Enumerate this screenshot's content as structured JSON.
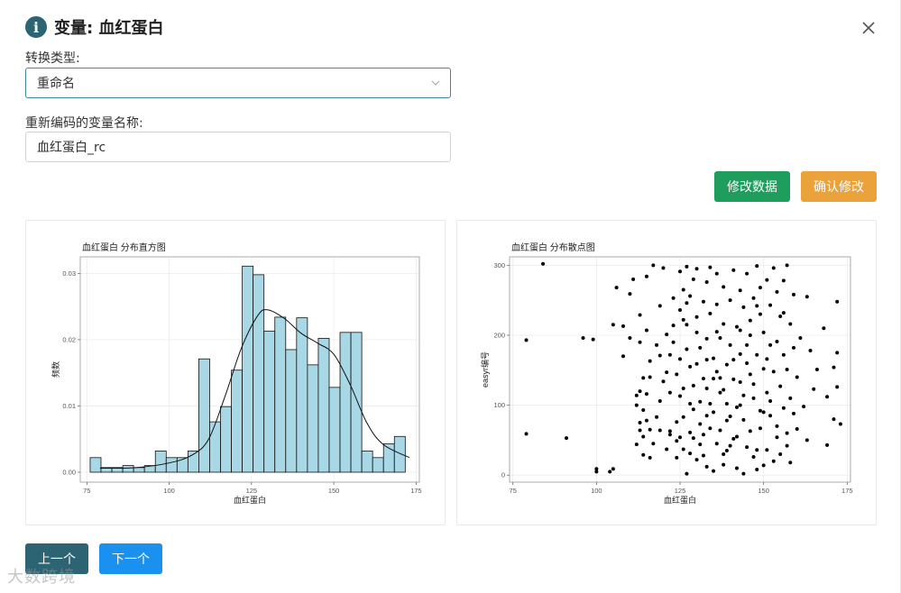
{
  "dialog": {
    "title": "变量: 血红蛋白",
    "info_icon_glyph": "i",
    "close_icon": "close-icon"
  },
  "form": {
    "convert_type_label": "转换类型:",
    "convert_type_value": "重命名",
    "new_name_label": "重新编码的变量名称:",
    "new_name_value": "血红蛋白_rc"
  },
  "actions": {
    "modify_data": "修改数据",
    "confirm_modify": "确认修改",
    "prev": "上一个",
    "next": "下一个"
  },
  "colors": {
    "accent": "#2c6473",
    "green": "#1e9d5d",
    "orange": "#eba23b",
    "blue": "#1a90ef",
    "bar_fill": "#a8d8e6"
  },
  "watermark": "大数跨境",
  "chart_data": [
    {
      "type": "bar",
      "title": "血红蛋白 分布直方图",
      "xlabel": "血红蛋白",
      "ylabel": "频数",
      "xlim": [
        73,
        176
      ],
      "ylim": [
        -0.0015,
        0.0325
      ],
      "xticks": [
        75,
        100,
        125,
        150,
        175
      ],
      "yticks": [
        0.0,
        0.01,
        0.02,
        0.03
      ],
      "ytick_labels": [
        "0.00",
        "0.01",
        "0.02",
        "0.03"
      ],
      "grid": true,
      "bin_start": 76,
      "bin_width": 3.3,
      "values": [
        0.0022,
        0.0007,
        0.0007,
        0.001,
        0.0007,
        0.001,
        0.0032,
        0.0022,
        0.0022,
        0.0032,
        0.0171,
        0.0076,
        0.0099,
        0.0154,
        0.0311,
        0.0298,
        0.0213,
        0.0234,
        0.0185,
        0.0233,
        0.0162,
        0.0202,
        0.0128,
        0.0211,
        0.0211,
        0.0032,
        0.0022,
        0.0043,
        0.0054
      ],
      "density_curve": [
        [
          79,
          0.0006
        ],
        [
          90,
          0.0007
        ],
        [
          100,
          0.0014
        ],
        [
          107,
          0.0026
        ],
        [
          112,
          0.005
        ],
        [
          117,
          0.0115
        ],
        [
          122,
          0.0188
        ],
        [
          127,
          0.0237
        ],
        [
          130,
          0.0245
        ],
        [
          135,
          0.0232
        ],
        [
          140,
          0.021
        ],
        [
          145,
          0.0195
        ],
        [
          150,
          0.0178
        ],
        [
          155,
          0.0132
        ],
        [
          160,
          0.0075
        ],
        [
          165,
          0.0042
        ],
        [
          173,
          0.0022
        ]
      ]
    },
    {
      "type": "scatter",
      "title": "血红蛋白 分布散点图",
      "xlabel": "血红蛋白",
      "ylabel": "easyr编号",
      "xlim": [
        74,
        176
      ],
      "ylim": [
        -10,
        312
      ],
      "xticks": [
        75,
        100,
        125,
        150,
        175
      ],
      "yticks": [
        0,
        100,
        200,
        300
      ],
      "grid": true,
      "points": [
        [
          79,
          193
        ],
        [
          79,
          59
        ],
        [
          84,
          302
        ],
        [
          91,
          53
        ],
        [
          96,
          196
        ],
        [
          99,
          194
        ],
        [
          100,
          9
        ],
        [
          100,
          5
        ],
        [
          104,
          5
        ],
        [
          105,
          9
        ],
        [
          105,
          215
        ],
        [
          106,
          268
        ],
        [
          108,
          213
        ],
        [
          108,
          170
        ],
        [
          110,
          259
        ],
        [
          110,
          196
        ],
        [
          111,
          280
        ],
        [
          112,
          44
        ],
        [
          112,
          114
        ],
        [
          112,
          100
        ],
        [
          113,
          64
        ],
        [
          113,
          190
        ],
        [
          113,
          229
        ],
        [
          113,
          75
        ],
        [
          114,
          139
        ],
        [
          114,
          93
        ],
        [
          114,
          55
        ],
        [
          114,
          29
        ],
        [
          115,
          284
        ],
        [
          115,
          207
        ],
        [
          115,
          78
        ],
        [
          115,
          116
        ],
        [
          116,
          65
        ],
        [
          116,
          25
        ],
        [
          116,
          163
        ],
        [
          117,
          300
        ],
        [
          118,
          83
        ],
        [
          119,
          242
        ],
        [
          119,
          171
        ],
        [
          119,
          106
        ],
        [
          120,
          296
        ],
        [
          120,
          134
        ],
        [
          121,
          37
        ],
        [
          121,
          147
        ],
        [
          122,
          63
        ],
        [
          122,
          118
        ],
        [
          122,
          58
        ],
        [
          123,
          253
        ],
        [
          123,
          190
        ],
        [
          123,
          214
        ],
        [
          124,
          49
        ],
        [
          124,
          25
        ],
        [
          124,
          76
        ],
        [
          125,
          291
        ],
        [
          125,
          236
        ],
        [
          125,
          166
        ],
        [
          125,
          113
        ],
        [
          126,
          37
        ],
        [
          126,
          83
        ],
        [
          126,
          265
        ],
        [
          126,
          124
        ],
        [
          127,
          298
        ],
        [
          127,
          2
        ],
        [
          127,
          215
        ],
        [
          127,
          180
        ],
        [
          128,
          256
        ],
        [
          128,
          155
        ],
        [
          128,
          61
        ],
        [
          128,
          31
        ],
        [
          129,
          128
        ],
        [
          129,
          280
        ],
        [
          129,
          94
        ],
        [
          130,
          295
        ],
        [
          130,
          204
        ],
        [
          130,
          226
        ],
        [
          130,
          159
        ],
        [
          131,
          105
        ],
        [
          131,
          73
        ],
        [
          131,
          44
        ],
        [
          132,
          248
        ],
        [
          132,
          138
        ],
        [
          132,
          28
        ],
        [
          133,
          276
        ],
        [
          133,
          195
        ],
        [
          133,
          124
        ],
        [
          133,
          12
        ],
        [
          134,
          297
        ],
        [
          134,
          231
        ],
        [
          134,
          67
        ],
        [
          135,
          167
        ],
        [
          135,
          90
        ],
        [
          135,
          6
        ],
        [
          136,
          288
        ],
        [
          136,
          244
        ],
        [
          136,
          148
        ],
        [
          136,
          45
        ],
        [
          137,
          196
        ],
        [
          137,
          118
        ],
        [
          137,
          64
        ],
        [
          138,
          269
        ],
        [
          138,
          216
        ],
        [
          138,
          15
        ],
        [
          139,
          158
        ],
        [
          139,
          102
        ],
        [
          139,
          35
        ],
        [
          140,
          250
        ],
        [
          140,
          186
        ],
        [
          140,
          84
        ],
        [
          141,
          293
        ],
        [
          141,
          137
        ],
        [
          141,
          52
        ],
        [
          142,
          212
        ],
        [
          142,
          97
        ],
        [
          142,
          10
        ],
        [
          143,
          264
        ],
        [
          143,
          173
        ],
        [
          143,
          133
        ],
        [
          144,
          240
        ],
        [
          144,
          79
        ],
        [
          144,
          2
        ],
        [
          145,
          288
        ],
        [
          145,
          186
        ],
        [
          145,
          40
        ],
        [
          146,
          221
        ],
        [
          146,
          144
        ],
        [
          146,
          63
        ],
        [
          147,
          253
        ],
        [
          147,
          110
        ],
        [
          147,
          26
        ],
        [
          148,
          299
        ],
        [
          148,
          172
        ],
        [
          148,
          8
        ],
        [
          149,
          268
        ],
        [
          149,
          230
        ],
        [
          149,
          67
        ],
        [
          150,
          204
        ],
        [
          150,
          152
        ],
        [
          150,
          14
        ],
        [
          151,
          279
        ],
        [
          151,
          118
        ],
        [
          151,
          36
        ],
        [
          152,
          243
        ],
        [
          152,
          186
        ],
        [
          152,
          85
        ],
        [
          153,
          296
        ],
        [
          153,
          148
        ],
        [
          153,
          20
        ],
        [
          154,
          262
        ],
        [
          154,
          191
        ],
        [
          154,
          54
        ],
        [
          155,
          227
        ],
        [
          155,
          127
        ],
        [
          155,
          30
        ],
        [
          156,
          278
        ],
        [
          156,
          172
        ],
        [
          156,
          96
        ],
        [
          157,
          300
        ],
        [
          157,
          151
        ],
        [
          157,
          42
        ],
        [
          158,
          216
        ],
        [
          158,
          110
        ],
        [
          158,
          18
        ],
        [
          159,
          258
        ],
        [
          159,
          182
        ],
        [
          160,
          140
        ],
        [
          160,
          66
        ],
        [
          161,
          196
        ],
        [
          162,
          98
        ],
        [
          163,
          255
        ],
        [
          163,
          50
        ],
        [
          164,
          178
        ],
        [
          165,
          123
        ],
        [
          166,
          151
        ],
        [
          168,
          210
        ],
        [
          169,
          43
        ],
        [
          169,
          112
        ],
        [
          171,
          154
        ],
        [
          171,
          80
        ],
        [
          172,
          248
        ],
        [
          172,
          175
        ],
        [
          172,
          126
        ],
        [
          173,
          73
        ],
        [
          118,
          186
        ],
        [
          121,
          201
        ],
        [
          126,
          222
        ],
        [
          131,
          182
        ],
        [
          136,
          205
        ],
        [
          141,
          165
        ],
        [
          146,
          200
        ],
        [
          151,
          166
        ],
        [
          156,
          232
        ],
        [
          116,
          140
        ],
        [
          119,
          64
        ],
        [
          124,
          144
        ],
        [
          129,
          53
        ],
        [
          134,
          102
        ],
        [
          139,
          78
        ],
        [
          144,
          114
        ],
        [
          149,
          92
        ],
        [
          154,
          70
        ],
        [
          159,
          88
        ],
        [
          113,
          120
        ],
        [
          117,
          45
        ],
        [
          122,
          172
        ],
        [
          127,
          246
        ],
        [
          132,
          58
        ],
        [
          137,
          139
        ],
        [
          142,
          55
        ],
        [
          147,
          130
        ],
        [
          152,
          106
        ],
        [
          157,
          60
        ],
        [
          133,
          85
        ],
        [
          138,
          122
        ],
        [
          143,
          100
        ],
        [
          148,
          36
        ],
        [
          125,
          54
        ],
        [
          130,
          22
        ],
        [
          135,
          138
        ],
        [
          140,
          42
        ],
        [
          145,
          160
        ],
        [
          150,
          90
        ],
        [
          128,
          102
        ],
        [
          133,
          165
        ],
        [
          138,
          30
        ],
        [
          143,
          207
        ],
        [
          148,
          242
        ]
      ]
    }
  ]
}
